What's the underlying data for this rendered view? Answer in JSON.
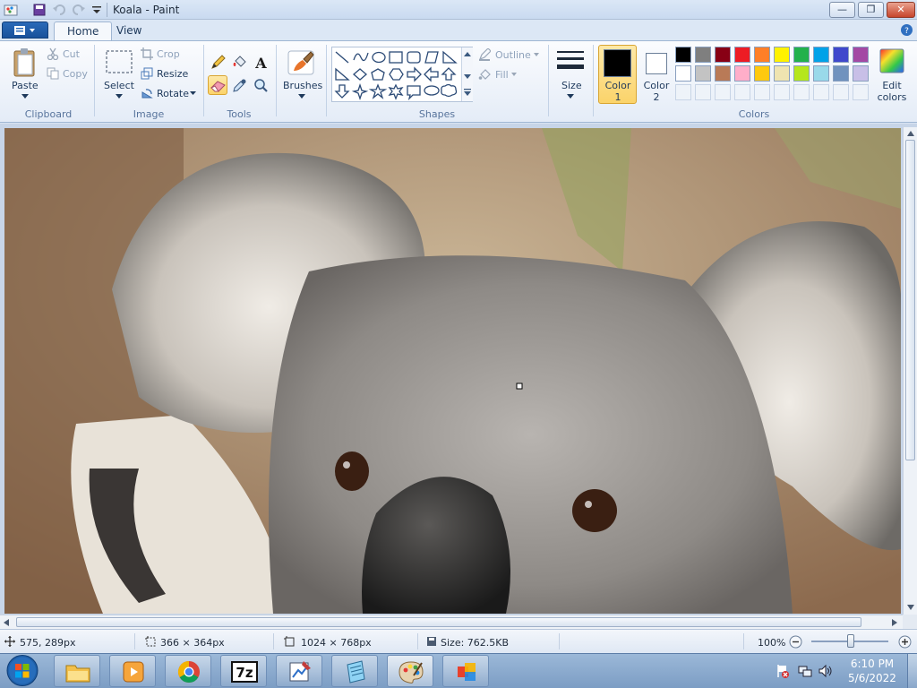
{
  "window": {
    "title": "Koala - Paint"
  },
  "tabs": [
    {
      "label": "Home"
    },
    {
      "label": "View"
    }
  ],
  "ribbon": {
    "clipboard": {
      "paste": "Paste",
      "cut": "Cut",
      "copy": "Copy",
      "group": "Clipboard"
    },
    "image": {
      "select": "Select",
      "crop": "Crop",
      "resize": "Resize",
      "rotate": "Rotate",
      "group": "Image"
    },
    "tools": {
      "group": "Tools"
    },
    "brushes": {
      "label": "Brushes"
    },
    "shapes": {
      "outline": "Outline",
      "fill": "Fill",
      "group": "Shapes"
    },
    "size": {
      "label": "Size"
    },
    "colors": {
      "color1": "Color 1",
      "color2": "Color 2",
      "edit": "Edit colors",
      "group": "Colors",
      "color1_value": "#000000",
      "color2_value": "#ffffff",
      "row1": [
        "#000000",
        "#7f7f7f",
        "#880015",
        "#ed1c24",
        "#ff7f27",
        "#fff200",
        "#22b14c",
        "#00a2e8",
        "#3f48cc",
        "#a349a4"
      ],
      "row2": [
        "#ffffff",
        "#c3c3c3",
        "#b97a57",
        "#ffaec9",
        "#ffc90e",
        "#efe4b0",
        "#b5e61d",
        "#99d9ea",
        "#7092be",
        "#c8bfe7"
      ]
    }
  },
  "status": {
    "cursor": "575, 289px",
    "selection": "366 × 364px",
    "image_size": "1024 × 768px",
    "file_size": "Size: 762.5KB",
    "zoom": "100%"
  },
  "taskbar": {
    "time": "6:10 PM",
    "date": "5/6/2022"
  }
}
